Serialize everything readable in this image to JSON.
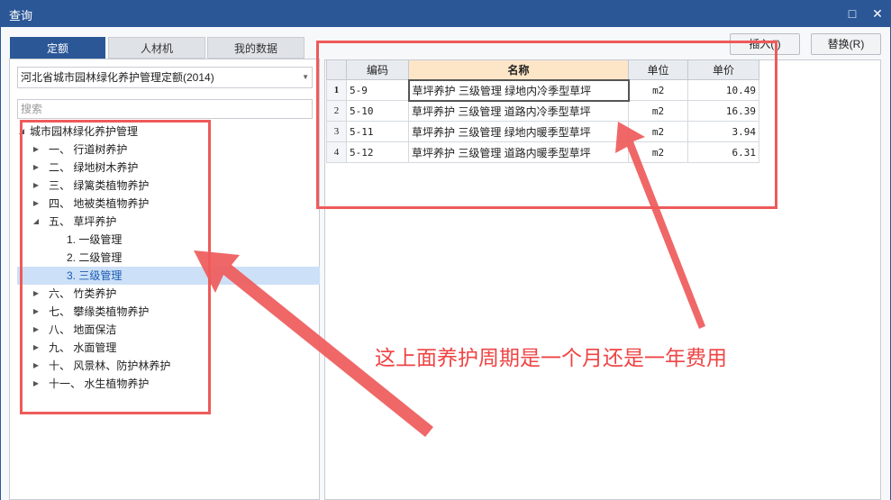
{
  "window": {
    "title": "查询",
    "restore_icon": "□",
    "close_icon": "✕"
  },
  "tabs": [
    {
      "label": "定额",
      "active": true
    },
    {
      "label": "人材机",
      "active": false
    },
    {
      "label": "我的数据",
      "active": false
    }
  ],
  "combo": {
    "value": "河北省城市园林绿化养护管理定额(2014)"
  },
  "search": {
    "placeholder": "搜索"
  },
  "tree": {
    "root": "城市园林绿化养护管理",
    "items": [
      {
        "label": "一、 行道树养护"
      },
      {
        "label": "二、 绿地树木养护"
      },
      {
        "label": "三、 绿篱类植物养护"
      },
      {
        "label": "四、 地被类植物养护"
      },
      {
        "label": "五、 草坪养护"
      },
      {
        "label": "1. 一级管理"
      },
      {
        "label": "2. 二级管理"
      },
      {
        "label": "3. 三级管理"
      },
      {
        "label": "六、 竹类养护"
      },
      {
        "label": "七、 攀缘类植物养护"
      },
      {
        "label": "八、 地面保洁"
      },
      {
        "label": "九、 水面管理"
      },
      {
        "label": "十、 风景林、防护林养护"
      },
      {
        "label": "十一、 水生植物养护"
      }
    ]
  },
  "buttons": {
    "insert": "插入(I)",
    "replace": "替换(R)"
  },
  "table": {
    "headers": [
      "编码",
      "名称",
      "单位",
      "单价"
    ],
    "rows": [
      {
        "no": "1",
        "code": "5-9",
        "name": "草坪养护 三级管理 绿地内冷季型草坪",
        "unit": "m2",
        "price": "10.49"
      },
      {
        "no": "2",
        "code": "5-10",
        "name": "草坪养护 三级管理 道路内冷季型草坪",
        "unit": "m2",
        "price": "16.39"
      },
      {
        "no": "3",
        "code": "5-11",
        "name": "草坪养护 三级管理 绿地内暖季型草坪",
        "unit": "m2",
        "price": "3.94"
      },
      {
        "no": "4",
        "code": "5-12",
        "name": "草坪养护 三级管理 道路内暖季型草坪",
        "unit": "m2",
        "price": "6.31"
      }
    ]
  },
  "annotation": {
    "text": "这上面养护周期是一个月还是一年费用",
    "color": "#ef4444"
  }
}
